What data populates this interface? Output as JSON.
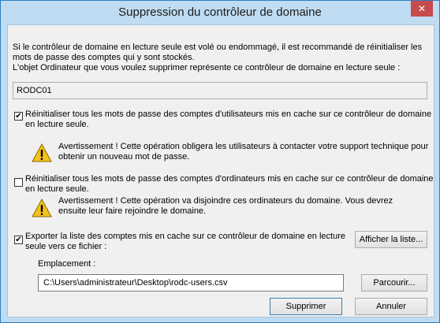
{
  "window": {
    "title": "Suppression du contrôleur de domaine",
    "close_glyph": "✕"
  },
  "intro": {
    "line1": "Si le contrôleur de domaine en lecture seule est volé ou endommagé, il est recommandé de réinitialiser les",
    "line2": "mots de passe des comptes qui y sont stockés.",
    "line3": "L'objet Ordinateur que vous voulez supprimer représente ce contrôleur de domaine en lecture seule :"
  },
  "computer_object": "RODC01",
  "option_user_passwords": {
    "checked": true,
    "check_glyph": "✔",
    "label_line1": "Réinitialiser tous les mots de passe des comptes d'utilisateurs mis en cache sur ce contrôleur de domaine",
    "label_line2": "en lecture seule.",
    "warning_line1": "Avertissement ! Cette opération obligera les utilisateurs à contacter votre support technique pour",
    "warning_line2": "obtenir un nouveau mot de passe."
  },
  "option_computer_passwords": {
    "checked": false,
    "label_line1": "Réinitialiser tous les mots de passe des comptes d'ordinateurs mis en cache sur ce contrôleur de domaine",
    "label_line2": "en lecture seule.",
    "warning_line1": "Avertissement ! Cette opération va disjoindre ces ordinateurs du domaine. Vous devrez",
    "warning_line2": "ensuite leur faire rejoindre le domaine."
  },
  "option_export": {
    "checked": true,
    "check_glyph": "✔",
    "label_line1": "Exporter la liste des comptes mis en cache sur ce contrôleur de domaine en lecture",
    "label_line2": "seule vers ce fichier :",
    "show_list_label": "Afficher la liste...",
    "location_label": "Emplacement :",
    "location_value": "C:\\Users\\administrateur\\Desktop\\rodc-users.csv",
    "browse_label": "Parcourir..."
  },
  "buttons": {
    "delete_label": "Supprimer",
    "cancel_label": "Annuler"
  },
  "icons": {
    "warning": "warning-triangle-icon",
    "close": "close-icon"
  }
}
